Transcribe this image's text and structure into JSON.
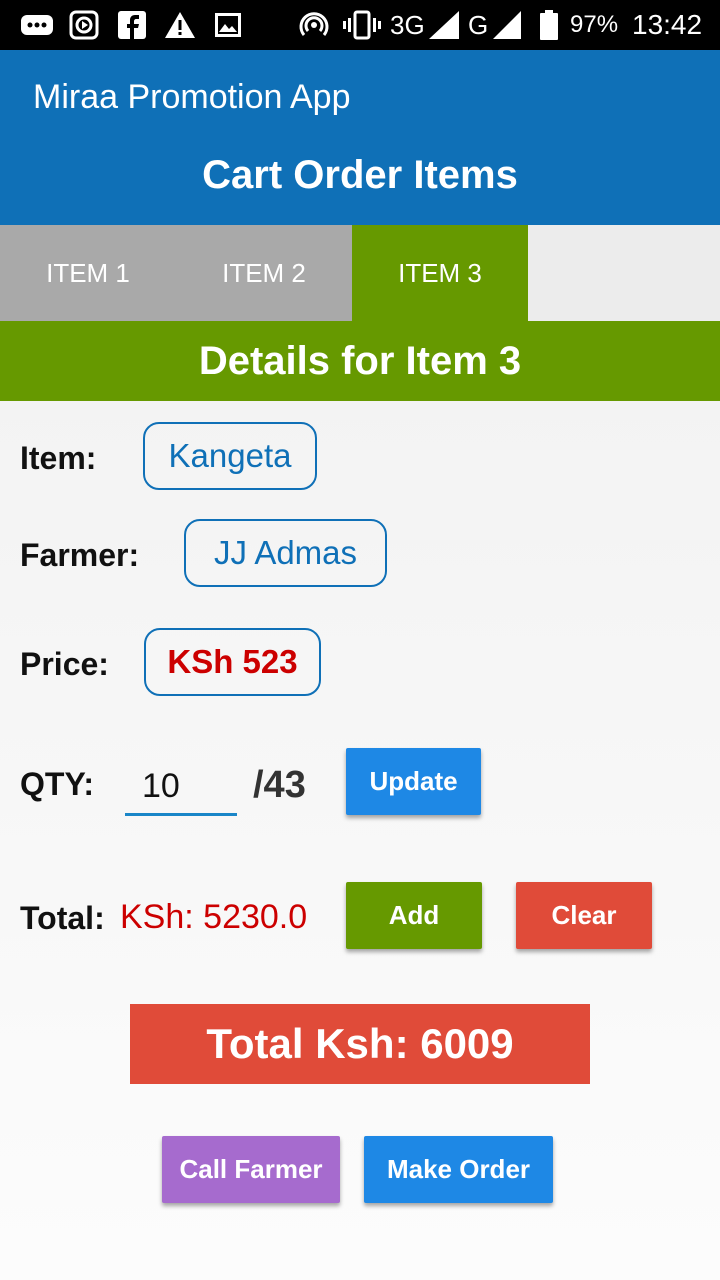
{
  "status_bar": {
    "icons": [
      "message-icon",
      "media-icon",
      "facebook-icon",
      "warning-icon",
      "image-icon",
      "hotspot-icon",
      "vibrate-icon",
      "signal-3g-icon",
      "signal-g-icon",
      "battery-icon"
    ],
    "network_3g": "3G",
    "network_g": "G",
    "battery": "97%",
    "time": "13:42"
  },
  "app_bar": {
    "app_title": "Miraa Promotion App",
    "page_title": "Cart Order Items",
    "color": "#0f70b7"
  },
  "tabs": [
    {
      "label": "ITEM 1",
      "active": false
    },
    {
      "label": "ITEM 2",
      "active": false
    },
    {
      "label": "ITEM 3",
      "active": true
    }
  ],
  "details": {
    "header": "Details for Item 3",
    "item_label": "Item:",
    "item_value": "Kangeta",
    "farmer_label": "Farmer:",
    "farmer_value": "JJ Admas",
    "price_label": "Price:",
    "price_value": "KSh 523",
    "qty_label": "QTY:",
    "qty_value": "10",
    "qty_max": "/43",
    "update_button": "Update",
    "total_label": "Total:",
    "total_value": "KSh: 5230.0",
    "add_button": "Add",
    "clear_button": "Clear"
  },
  "grand_total": "Total Ksh: 6009",
  "actions": {
    "call_farmer": "Call Farmer",
    "make_order": "Make Order"
  },
  "colors": {
    "green": "#669900",
    "blue_button": "#1e88e5",
    "red": "#e04b39",
    "purple": "#a66bce",
    "price_red": "#cc0000"
  }
}
